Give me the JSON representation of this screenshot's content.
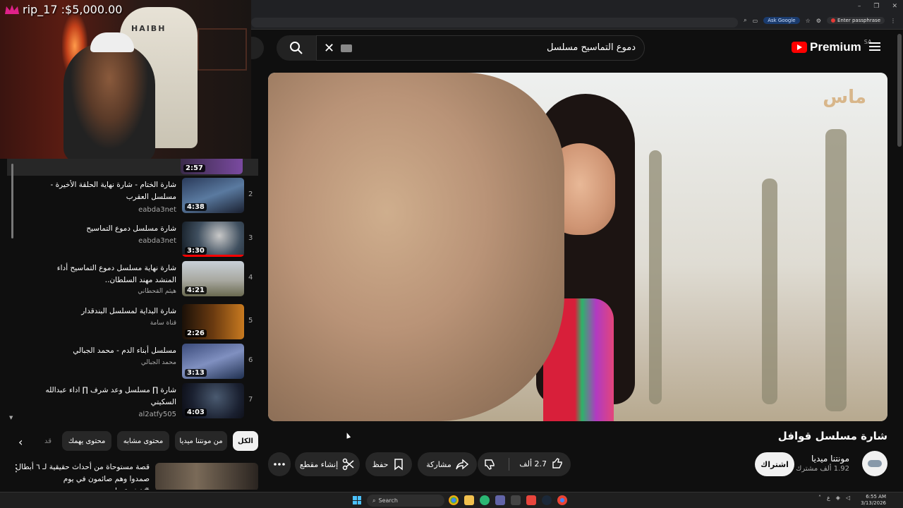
{
  "webcam": {
    "label": "rip_17 :$5,000.00",
    "chair_text": "HAIBH"
  },
  "browser": {
    "ask_google": "Ask Google",
    "passphrase": "Enter passphrase"
  },
  "header": {
    "search_query": "دموع التماسيح مسلسل",
    "logo_text": "Premium",
    "region": "SA"
  },
  "player": {
    "channel_watermark": "ماس"
  },
  "video": {
    "title": "شارة مسلسل قوافل",
    "channel_name": "مونتنا ميديا",
    "subscribers": "1.92 ألف مشترك",
    "subscribe_label": "اشتراك",
    "like_count": "2.7 ألف",
    "share_label": "مشاركة",
    "save_label": "حفظ",
    "clip_label": "إنشاء مقطع"
  },
  "playlist": {
    "active_duration": "2:57",
    "items": [
      {
        "index": "2",
        "title": "شارة الختام - شارة نهاية الحلقة الأخيرة - مسلسل العقرب",
        "channel": "eabda3net",
        "duration": "4:38"
      },
      {
        "index": "3",
        "title": "شارة مسلسل دموع التماسيح",
        "channel": "eabda3net",
        "duration": "3:30"
      },
      {
        "index": "4",
        "title": "شارة نهاية مسلسل دموع التماسيح أداء المنشد مهند السلطان..",
        "channel": "هيثم القحطاني",
        "duration": "4:21"
      },
      {
        "index": "5",
        "title": "شارة البداية لمسلسل البندقدار",
        "channel": "قناة سامة",
        "duration": "2:26"
      },
      {
        "index": "6",
        "title": "مسلسل أبناء الدم - محمد الجبالي",
        "channel": "محمد الجبالي",
        "duration": "3:13"
      },
      {
        "index": "7",
        "title": "شارة ∏ مسلسل وعد شرف ∏ اداء عبدالله السكيتي",
        "channel": "al2atfy505",
        "duration": "4:03"
      }
    ]
  },
  "chips": {
    "all": "الكل",
    "from_channel": "من مونتنا ميديا",
    "similar": "محتوى مشابه",
    "for_you": "محتوى يهمك",
    "partial": "قد"
  },
  "recommendation": {
    "title": "قصة مستوحاة من أحداث حقيقية لـ ٦ أبطال صمدوا وهم صائمون في يوم #عشرة_واحد..."
  },
  "taskbar": {
    "search_placeholder": "Search",
    "time": "6:55 AM",
    "date": "3/13/2026",
    "lang": "ع"
  }
}
